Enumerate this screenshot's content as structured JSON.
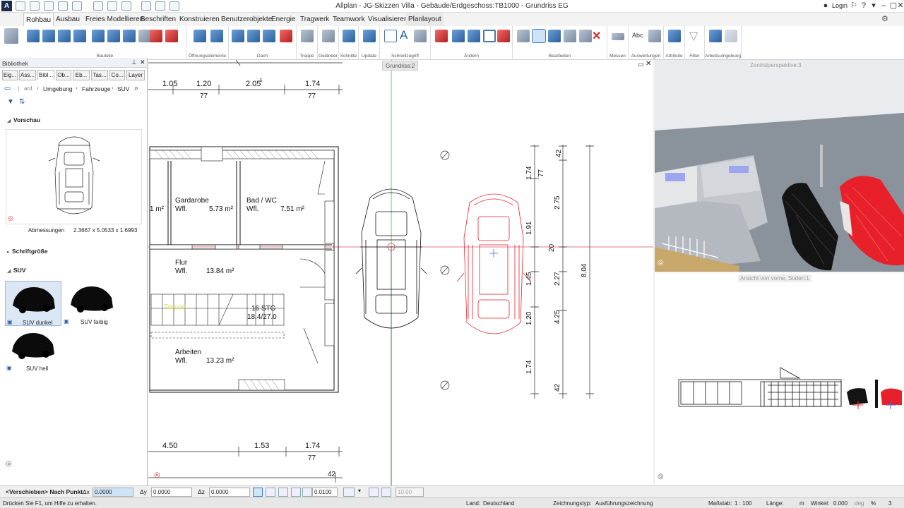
{
  "app": {
    "window_title": "Allplan - JG-Skizzen Villa - Gebäude/Erdgeschoss:TB1000 - Grundriss EG",
    "logo": "A",
    "login": "Login"
  },
  "tabs": [
    "Rohbau",
    "Ausbau",
    "Freies Modellieren",
    "Beschriften",
    "Konstruieren",
    "Benutzerobjekte",
    "Energie",
    "Tragwerk",
    "Teamwork",
    "Visualisieren",
    "Planlayout"
  ],
  "ribbon_groups": [
    "Bauteile",
    "Öffnungselemente",
    "Dach",
    "Treppe",
    "Geländer",
    "Schnitte",
    "Update",
    "Schnellzugriff",
    "Ändern",
    "Bearbeiten",
    "Messen",
    "Auswertungen",
    "Attribute",
    "Filter",
    "Arbeitsumgebung"
  ],
  "ribbon_text_icons": {
    "text_a": "A",
    "abc": "Abc"
  },
  "library": {
    "title": "Bibliothek",
    "tabs": [
      "Eig...",
      "Ass...",
      "Bibl...",
      "Ob...",
      "Eb...",
      "Tas...",
      "Co...",
      "Layer"
    ],
    "breadcrumb_prefix": "ard",
    "breadcrumb": [
      "Umgebung",
      "Fahrzeuge",
      "SUV"
    ],
    "preview_title": "Vorschau",
    "dimensions_label": "Abmessungen",
    "dimensions_value": "2.3667 x 5.0533 x 1.6993",
    "font_size_label": "Schriftgröße",
    "suv_section": "SUV",
    "items": [
      {
        "label": "SUV dunkel",
        "selected": true
      },
      {
        "label": "SUV farbig",
        "selected": false
      },
      {
        "label": "SUV hell",
        "selected": false
      }
    ]
  },
  "views": {
    "plan_title": "Grundriss:2",
    "perspective_title": "Zentralperspektive:3",
    "elevation_title": "Ansicht von vorne, Süden:1"
  },
  "plan": {
    "rooms": [
      {
        "name": "Gardarobe",
        "area_label": "Wfl.",
        "area": "5.73 m²"
      },
      {
        "name": "Bad / WC",
        "area_label": "Wfl.",
        "area": "7.51 m²"
      },
      {
        "name": "Flur",
        "area_label": "Wfl.",
        "area": "13.84 m²"
      },
      {
        "name": "Arbeiten",
        "area_label": "Wfl.",
        "area": "13.23 m²"
      }
    ],
    "partial_area": "1 m²",
    "stair": {
      "label": "Treppe",
      "steps": "16 STG",
      "ratio": "18.4/27.0"
    },
    "top_dims": [
      "1.05",
      "1.20",
      "2.05",
      "1.74"
    ],
    "top_dims_sub": [
      "77",
      "77"
    ],
    "top_dim_superscript": "5",
    "bottom_dims": [
      "4.50",
      "1.53",
      "1.74"
    ],
    "bottom_dims_sub": [
      "77",
      "42"
    ],
    "vertical_dims_a": [
      "1.74",
      "77",
      "1.91",
      "1.45",
      "1.20",
      "1.74"
    ],
    "vertical_dims_b": [
      "42",
      "2.75",
      "20",
      "2.27",
      "4.25",
      "42"
    ],
    "vertical_total": "8.04"
  },
  "inputbar": {
    "command": "<Verschieben> Nach Punkt",
    "dx_label": "Δx",
    "dx": "0.0000",
    "dy_label": "Δy",
    "dy": "0.0000",
    "dz_label": "Δz",
    "dz": "0.0000",
    "step": "0.0100",
    "angle": "10.00"
  },
  "statusbar": {
    "hint": "Drücken Sie F1, um Hilfe zu erhalten.",
    "country_label": "Land:",
    "country": "Deutschland",
    "drawtype_label": "Zeichnungstyp:",
    "drawtype": "Ausführungszeichnung",
    "scale_label": "Maßstab:",
    "scale": "1 : 100",
    "length_label": "Länge:",
    "length": "m",
    "angle_label": "Winkel:",
    "angle": "0.000",
    "unit": "deg",
    "percent_label": "%",
    "percent": "3"
  },
  "colors": {
    "accent": "#3c7fc7",
    "red_car": "#e8202a",
    "green_axis": "#39c339"
  }
}
